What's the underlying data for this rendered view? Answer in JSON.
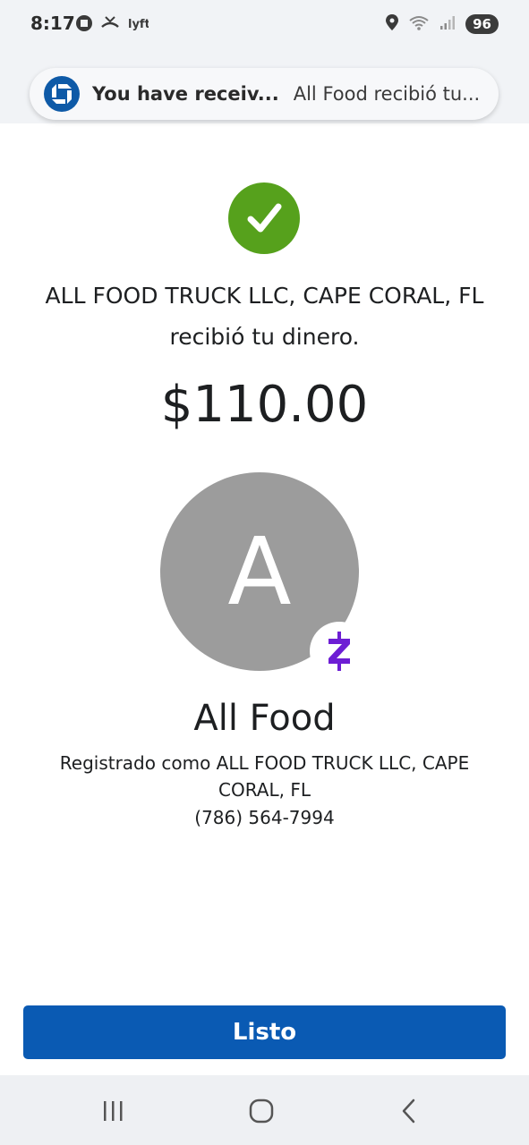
{
  "status_bar": {
    "time": "8:17",
    "battery": "96",
    "icons": [
      "chase-icon",
      "missed-call-icon",
      "lyft-icon",
      "location-icon",
      "wifi-icon",
      "signal-icon"
    ]
  },
  "notification": {
    "title": "You have receiv...",
    "body": "All Food recibió tu..."
  },
  "confirmation": {
    "message": "ALL FOOD TRUCK LLC, CAPE CORAL, FL recibió tu dinero.",
    "amount": "$110.00"
  },
  "recipient": {
    "avatar_letter": "A",
    "name": "All Food",
    "registered": "Registrado como ALL FOOD TRUCK LLC, CAPE CORAL, FL",
    "phone": "(786) 564-7994"
  },
  "actions": {
    "done_label": "Listo"
  },
  "colors": {
    "success": "#56a11c",
    "primary": "#0a5ab3",
    "zelle": "#6d1ed4",
    "avatar": "#9c9c9c"
  }
}
